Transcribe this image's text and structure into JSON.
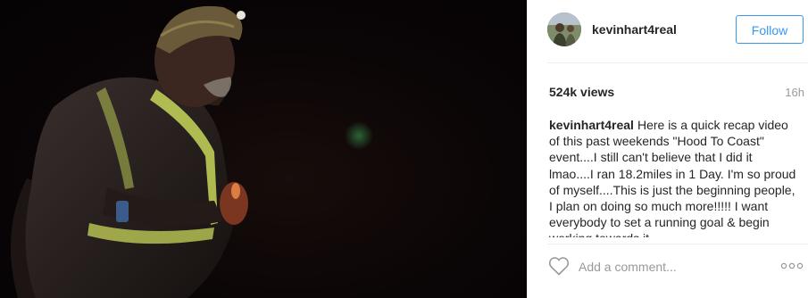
{
  "post": {
    "author": {
      "username": "kevinhart4real",
      "avatar_icon": "profile-photo-avatar"
    },
    "follow_label": "Follow",
    "views": "524k views",
    "time_ago": "16h",
    "caption": {
      "username": "kevinhart4real",
      "text": "Here is a quick recap video of this past weekends \"Hood To Coast\" event....I still can't believe that I did it lmao....I ran 18.2miles in 1 Day. I'm so proud of myself....This is just the beginning people, I plan on doing so much more!!!!! I want everybody to set a running goal & begin working towards it"
    },
    "comment_placeholder": "Add a comment...",
    "icons": {
      "like": "heart-outline-icon",
      "more": "more-options-icon"
    },
    "colors": {
      "accent": "#3897f0",
      "text": "#262626",
      "muted": "#999999",
      "reflective_vest": "#c8d65a"
    }
  }
}
